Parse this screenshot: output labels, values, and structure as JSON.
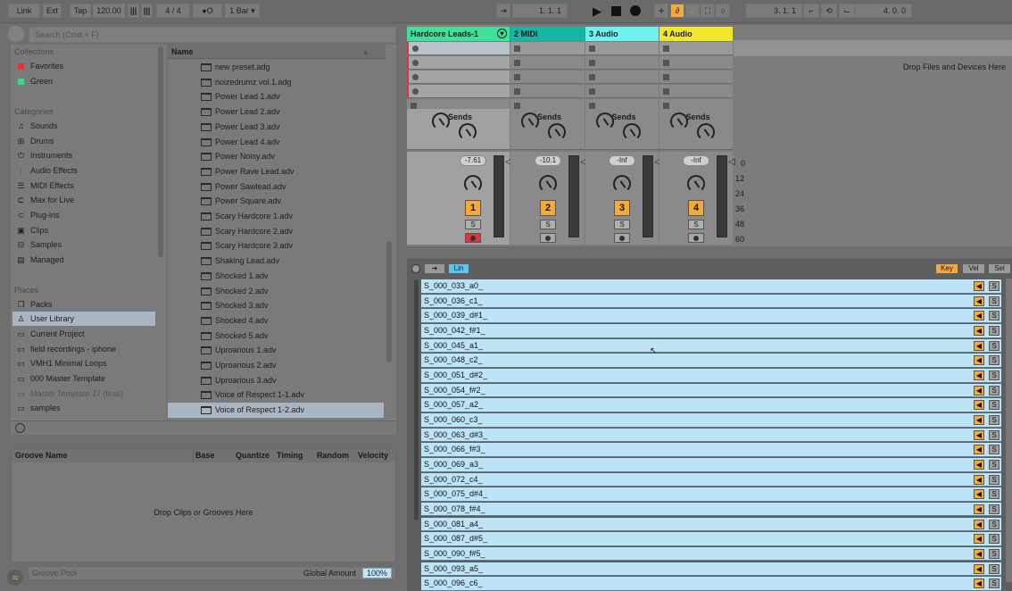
{
  "toolbar": {
    "link": "Link",
    "ext": "Ext",
    "tap": "Tap",
    "tempo": "120.00",
    "time_signature": "4 / 4",
    "metronome": "●O",
    "quantize": "1 Bar",
    "arrangement_position": "1.   1.   1",
    "loop_start": "3.   1.   1",
    "loop_length": "4.   0.   0"
  },
  "browser": {
    "search_placeholder": "Search (Cmd + F)",
    "collections_label": "Collections",
    "collections": [
      {
        "label": "Favorites",
        "color": "#e0343a"
      },
      {
        "label": "Green",
        "color": "#3ad68a"
      }
    ],
    "categories_label": "Categories",
    "categories": [
      {
        "label": "Sounds",
        "icon": "music-note-icon"
      },
      {
        "label": "Drums",
        "icon": "grid-icon"
      },
      {
        "label": "Instruments",
        "icon": "power-icon"
      },
      {
        "label": "Audio Effects",
        "icon": "waveform-icon"
      },
      {
        "label": "MIDI Effects",
        "icon": "midi-icon"
      },
      {
        "label": "Max for Live",
        "icon": "max-icon"
      },
      {
        "label": "Plug-ins",
        "icon": "plug-icon"
      },
      {
        "label": "Clips",
        "icon": "clip-icon"
      },
      {
        "label": "Samples",
        "icon": "sample-icon"
      },
      {
        "label": "Managed",
        "icon": "managed-icon"
      }
    ],
    "places_label": "Places",
    "places": [
      {
        "label": "Packs",
        "icon": "packs-icon"
      },
      {
        "label": "User Library",
        "icon": "user-icon",
        "selected": true
      },
      {
        "label": "Current Project",
        "icon": "folder-icon"
      },
      {
        "label": "field recordings - iphone",
        "icon": "folder-icon"
      },
      {
        "label": "VMH1 Minimal Loops",
        "icon": "folder-icon"
      },
      {
        "label": "000 Master Template",
        "icon": "folder-icon"
      },
      {
        "label": "Master Template 27 (final)",
        "icon": "folder-icon",
        "dim": true
      },
      {
        "label": "samples",
        "icon": "folder-icon"
      }
    ],
    "name_header": "Name",
    "files": [
      "new preset.adg",
      "noizedrumz vol.1.adg",
      "Power Lead 1.adv",
      "Power Lead 2.adv",
      "Power Lead 3.adv",
      "Power Lead 4.adv",
      "Power Noisy.adv",
      "Power Rave Lead.adv",
      "Power Sawlead.adv",
      "Power Square.adv",
      "Scary Hardcore 1.adv",
      "Scary Hardcore 2.adv",
      "Scary Hardcore 3.adv",
      "Shaking Lead.adv",
      "Shocked 1.adv",
      "Shocked 2.adv",
      "Shocked 3.adv",
      "Shocked 4.adv",
      "Shocked 5.adv",
      "Uproarious 1.adv",
      "Uproarious 2.adv",
      "Uproarious 3.adv",
      "Voice of Respect 1-1.adv",
      "Voice of Respect 1-2.adv"
    ],
    "selected_file": "Voice of Respect 1-2.adv"
  },
  "groove": {
    "columns": [
      "Groove Name",
      "Base",
      "Quantize",
      "Timing",
      "Random",
      "Velocity"
    ],
    "empty": "Drop Clips or Grooves Here",
    "pool_label": "Groove Pool",
    "global_amount_label": "Global Amount",
    "global_amount": "100%"
  },
  "session": {
    "drop_hint": "Drop Files and Devices Here",
    "sends_label": "Sends",
    "tracks": [
      {
        "name": "Hardcore Leads-1",
        "color": "#3fe19a",
        "volume": "-7.61",
        "number": "1",
        "solo": "S",
        "armed": true
      },
      {
        "name": "2 MIDI",
        "color": "#16b5a6",
        "volume": "-10.1",
        "number": "2",
        "solo": "S",
        "armed": false
      },
      {
        "name": "3 Audio",
        "color": "#6ff2ef",
        "volume": "-Inf",
        "number": "3",
        "solo": "S",
        "armed": false
      },
      {
        "name": "4 Audio",
        "color": "#f2e62e",
        "volume": "-Inf",
        "number": "4",
        "solo": "S",
        "armed": false
      }
    ],
    "meter_scale": [
      "0",
      "12",
      "24",
      "36",
      "48",
      "60"
    ]
  },
  "chain_list": {
    "lin_label": "Lin",
    "key_label": "Key",
    "vel_label": "Vel",
    "sel_label": "Sel",
    "solo_label": "S",
    "rows": [
      "S_000_033_a0_",
      "S_000_036_c1_",
      "S_000_039_d#1_",
      "S_000_042_f#1_",
      "S_000_045_a1_",
      "S_000_048_c2_",
      "S_000_051_d#2_",
      "S_000_054_f#2_",
      "S_000_057_a2_",
      "S_000_060_c3_",
      "S_000_063_d#3_",
      "S_000_066_f#3_",
      "S_000_069_a3_",
      "S_000_072_c4_",
      "S_000_075_d#4_",
      "S_000_078_f#4_",
      "S_000_081_a4_",
      "S_000_087_d#5_",
      "S_000_090_f#5_",
      "S_000_093_a5_",
      "S_000_096_c6_"
    ]
  }
}
